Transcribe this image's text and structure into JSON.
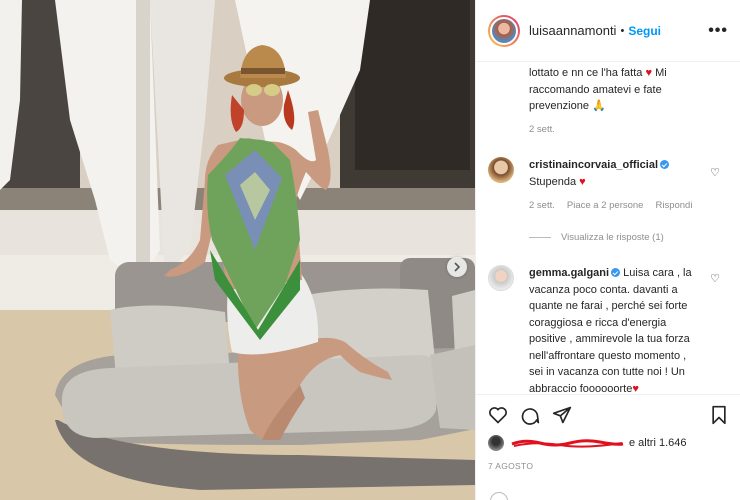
{
  "header": {
    "username": "luisaannamonti",
    "separator": "•",
    "follow_label": "Segui",
    "more_label": "•••"
  },
  "comments": [
    {
      "text_lines": [
        "lottato e nn ce l'ha fatta",
        "raccomando amatevi e fate",
        "prevenzione"
      ],
      "text_tail_1": "Mi",
      "meta_time": "2 sett."
    },
    {
      "user": "cristinaincorvaia_official",
      "text": "Stupenda",
      "meta_time": "2 sett.",
      "meta_likes": "Piace a 2 persone",
      "meta_reply": "Rispondi",
      "view_replies": "Visualizza le risposte (1)"
    },
    {
      "user": "gemma.galgani",
      "text_lines": [
        "Luisa cara , la",
        "vacanza poco conta. davanti a",
        "quante ne farai , perché sei forte",
        "coraggiosa e ricca d'energia",
        "positive , ammirevole la tua forza",
        "nell'affrontare questo momento ,",
        "sei in vacanza con tutte noi ! Un",
        "abbraccio foooooorte"
      ]
    }
  ],
  "actions": {
    "likes_suffix": "e altri 1.646",
    "date": "7 AGOSTO"
  },
  "icons": {
    "header_more": "more-icon",
    "like": "heart-icon",
    "comment": "comment-icon",
    "share": "share-icon",
    "save": "bookmark-icon",
    "next": "chevron-right-icon"
  },
  "colors": {
    "follow_blue": "#0095f6",
    "verified_blue": "#3897f0",
    "heart_red": "#e0101f",
    "meta_gray": "#8e8e8e"
  }
}
